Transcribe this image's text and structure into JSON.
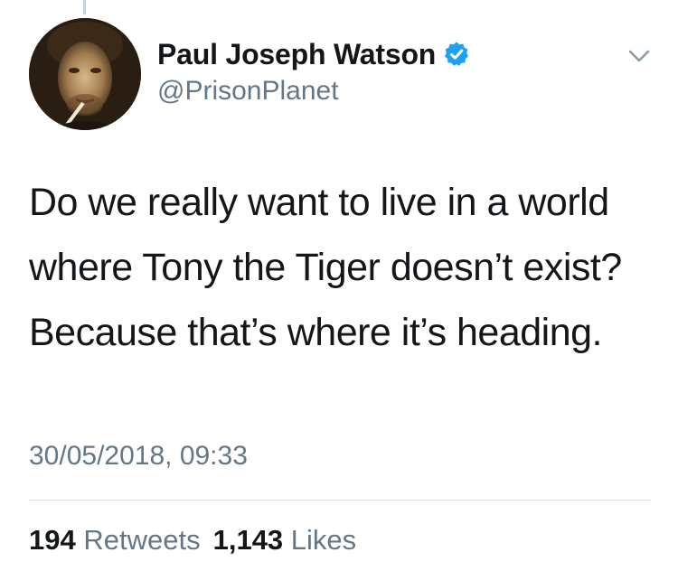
{
  "author": {
    "display_name": "Paul Joseph Watson",
    "handle": "@PrisonPlanet",
    "verified": true,
    "avatar_icon": "profile-photo"
  },
  "tweet": {
    "text": "Do we really want to live in a world where Tony the Tiger doesn’t exist? Because that’s where it’s heading.",
    "timestamp": "30/05/2018, 09:33"
  },
  "stats": {
    "retweets_count": "194",
    "retweets_label": "Retweets",
    "likes_count": "1,143",
    "likes_label": "Likes"
  },
  "colors": {
    "text_primary": "#14171a",
    "text_secondary": "#657786",
    "verified_blue": "#1da1f2"
  },
  "icons": {
    "verified": "verified-badge-icon",
    "menu": "chevron-down-icon"
  }
}
